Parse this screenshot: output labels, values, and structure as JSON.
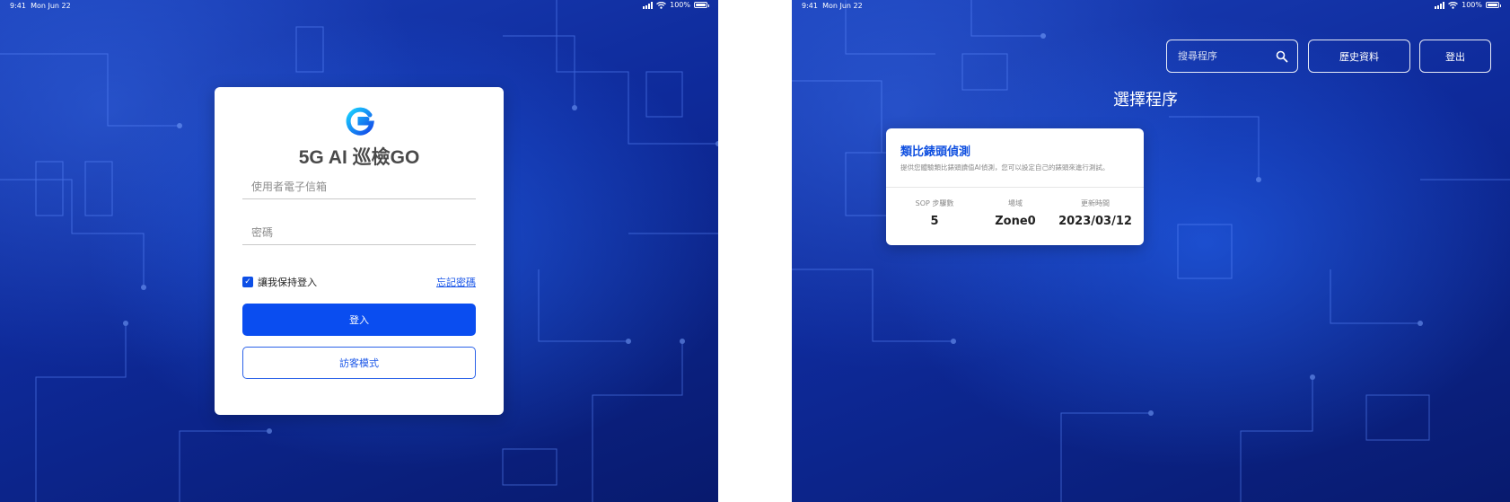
{
  "status_bar": {
    "time": "9:41",
    "date": "Mon Jun 22",
    "battery": "100%",
    "battery_level": 1.0
  },
  "login": {
    "app_title": "5G AI 巡檢GO",
    "email_placeholder": "使用者電子信箱",
    "password_placeholder": "密碼",
    "remember_label": "讓我保持登入",
    "remember_checked": true,
    "forgot_label": "忘記密碼",
    "login_label": "登入",
    "guest_label": "訪客模式"
  },
  "select": {
    "search_placeholder": "搜尋程序",
    "history_label": "歷史資料",
    "logout_label": "登出",
    "page_title": "選擇程序",
    "card": {
      "name": "類比錶頭偵測",
      "description": "提供您體驗類比錶頭讀值AI偵測，您可以設定自己的錶頭來進行測試。",
      "stats": [
        {
          "label": "SOP 步驟數",
          "value": "5"
        },
        {
          "label": "場域",
          "value": "Zone0"
        },
        {
          "label": "更新時間",
          "value": "2023/03/12"
        }
      ]
    }
  },
  "colors": {
    "accent": "#0a4df0",
    "link": "#1a56e8",
    "background": "#0e2a9a"
  },
  "icons": [
    "signal-icon",
    "wifi-icon",
    "battery-icon",
    "app-logo-icon",
    "check-icon",
    "search-icon"
  ]
}
